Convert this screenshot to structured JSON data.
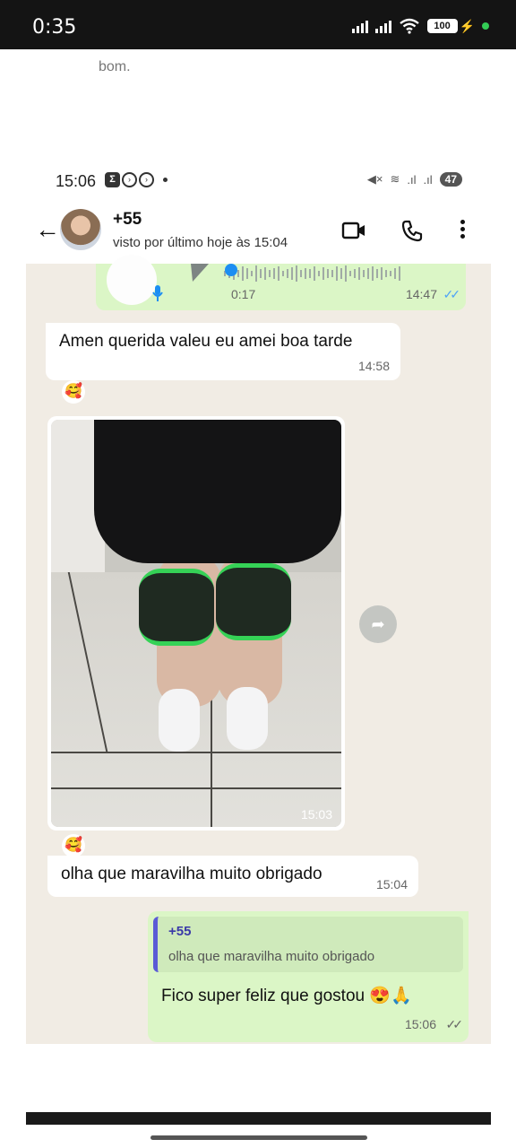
{
  "outer_status": {
    "time": "0:35",
    "battery": "100"
  },
  "previous_text": "bom.",
  "inner_status": {
    "time": "15:06",
    "battery": "47",
    "icons": [
      "notification-box-icon",
      "circle-icon",
      "circle-icon",
      "dot-icon",
      "muted-icon",
      "wifi-icon",
      "signal-icon"
    ]
  },
  "header": {
    "contact_name": "+55",
    "last_seen": "visto por último hoje às 15:04",
    "actions": [
      "back-arrow-icon",
      "video-call-icon",
      "voice-call-icon",
      "more-options-icon"
    ]
  },
  "messages": [
    {
      "type": "audio",
      "direction": "outgoing",
      "duration": "0:17",
      "time": "14:47",
      "status": "read"
    },
    {
      "type": "text",
      "direction": "incoming",
      "text": "Amen querida valeu eu amei boa tarde",
      "time": "14:58",
      "reaction": "🥰"
    },
    {
      "type": "image",
      "direction": "incoming",
      "time": "15:03",
      "reaction": "🥰"
    },
    {
      "type": "text",
      "direction": "incoming",
      "text": "olha que maravilha muito obrigado",
      "time": "15:04"
    },
    {
      "type": "reply",
      "direction": "outgoing",
      "quoted_name": "+55",
      "quoted_text": "olha que maravilha muito obrigado",
      "text": "Fico super feliz que gostou 😍🙏",
      "time": "15:06",
      "status": "delivered"
    }
  ],
  "colors": {
    "outgoing": "#dbf6c6",
    "incoming": "#ffffff",
    "wallpaper": "#f1ece4",
    "read_ticks": "#4fa3f7",
    "quote_bar": "#5b5bd6"
  }
}
